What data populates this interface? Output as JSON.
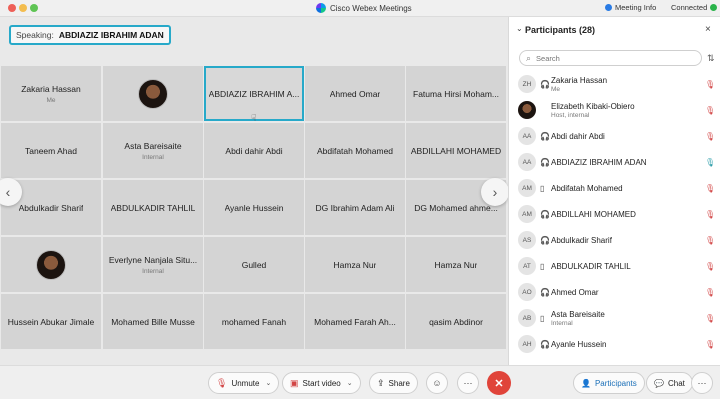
{
  "window": {
    "title": "Cisco Webex Meetings",
    "meeting_info": "Meeting Info",
    "connection": "Connected"
  },
  "speaking": {
    "label": "Speaking:",
    "name": "ABDIAZIZ IBRAHIM ADAN"
  },
  "grid": {
    "tiles": [
      {
        "name": "Zakaria Hassan",
        "sub": "Me"
      },
      {
        "name": "",
        "sub": "",
        "photo": true
      },
      {
        "name": "ABDIAZIZ IBRAHIM A...",
        "sub": "",
        "active": true
      },
      {
        "name": "Ahmed Omar",
        "sub": ""
      },
      {
        "name": "Fatuma Hirsi Moham...",
        "sub": ""
      },
      {
        "name": "Taneem Ahad",
        "sub": ""
      },
      {
        "name": "Asta Bareisaite",
        "sub": "Internal"
      },
      {
        "name": "Abdi dahir Abdi",
        "sub": ""
      },
      {
        "name": "Abdifatah Mohamed",
        "sub": ""
      },
      {
        "name": "ABDILLAHI MOHAMED",
        "sub": ""
      },
      {
        "name": "Abdulkadir Sharif",
        "sub": ""
      },
      {
        "name": "ABDULKADIR TAHLIL",
        "sub": ""
      },
      {
        "name": "Ayanle Hussein",
        "sub": ""
      },
      {
        "name": "DG Ibrahim Adam Ali",
        "sub": ""
      },
      {
        "name": "DG Mohamed ahme...",
        "sub": ""
      },
      {
        "name": "",
        "sub": "",
        "photo": true
      },
      {
        "name": "Everlyne Nanjala Situ...",
        "sub": "Internal"
      },
      {
        "name": "Gulled",
        "sub": ""
      },
      {
        "name": "Hamza Nur",
        "sub": ""
      },
      {
        "name": "Hamza Nur",
        "sub": ""
      },
      {
        "name": "Hussein Abukar Jimale",
        "sub": ""
      },
      {
        "name": "Mohamed Bille Musse",
        "sub": ""
      },
      {
        "name": "mohamed Fanah",
        "sub": ""
      },
      {
        "name": "Mohamed Farah Ah...",
        "sub": ""
      },
      {
        "name": "qasim Abdinor",
        "sub": ""
      }
    ]
  },
  "participants": {
    "title": "Participants (28)",
    "search_placeholder": "Search",
    "list": [
      {
        "initials": "ZH",
        "name": "Zakaria Hassan",
        "sub": "Me",
        "device": "headset",
        "mic": "muted"
      },
      {
        "initials": "",
        "name": "Elizabeth Kibaki-Obiero",
        "sub": "Host, internal",
        "device": "none",
        "mic": "muted",
        "photo": true
      },
      {
        "initials": "AA",
        "name": "Abdi dahir Abdi",
        "sub": "",
        "device": "headset",
        "mic": "muted"
      },
      {
        "initials": "AA",
        "name": "ABDIAZIZ IBRAHIM ADAN",
        "sub": "",
        "device": "headset",
        "mic": "on"
      },
      {
        "initials": "AM",
        "name": "Abdifatah Mohamed",
        "sub": "",
        "device": "phone",
        "mic": "muted"
      },
      {
        "initials": "AM",
        "name": "ABDILLAHI MOHAMED",
        "sub": "",
        "device": "headset",
        "mic": "muted"
      },
      {
        "initials": "AS",
        "name": "Abdulkadir Sharif",
        "sub": "",
        "device": "headset",
        "mic": "muted"
      },
      {
        "initials": "AT",
        "name": "ABDULKADIR TAHLIL",
        "sub": "",
        "device": "phone",
        "mic": "muted"
      },
      {
        "initials": "AO",
        "name": "Ahmed Omar",
        "sub": "",
        "device": "headset",
        "mic": "muted"
      },
      {
        "initials": "AB",
        "name": "Asta Bareisaite",
        "sub": "Internal",
        "device": "phone",
        "mic": "muted"
      },
      {
        "initials": "AH",
        "name": "Ayanle Hussein",
        "sub": "",
        "device": "headset",
        "mic": "muted"
      }
    ]
  },
  "controls": {
    "unmute": "Unmute",
    "start_video": "Start video",
    "share": "Share",
    "participants": "Participants",
    "chat": "Chat"
  },
  "colors": {
    "accent": "#27a9c9",
    "end_call": "#e0443a",
    "muted_mic": "#d24545",
    "selected_tab": "#1a6fb8"
  }
}
